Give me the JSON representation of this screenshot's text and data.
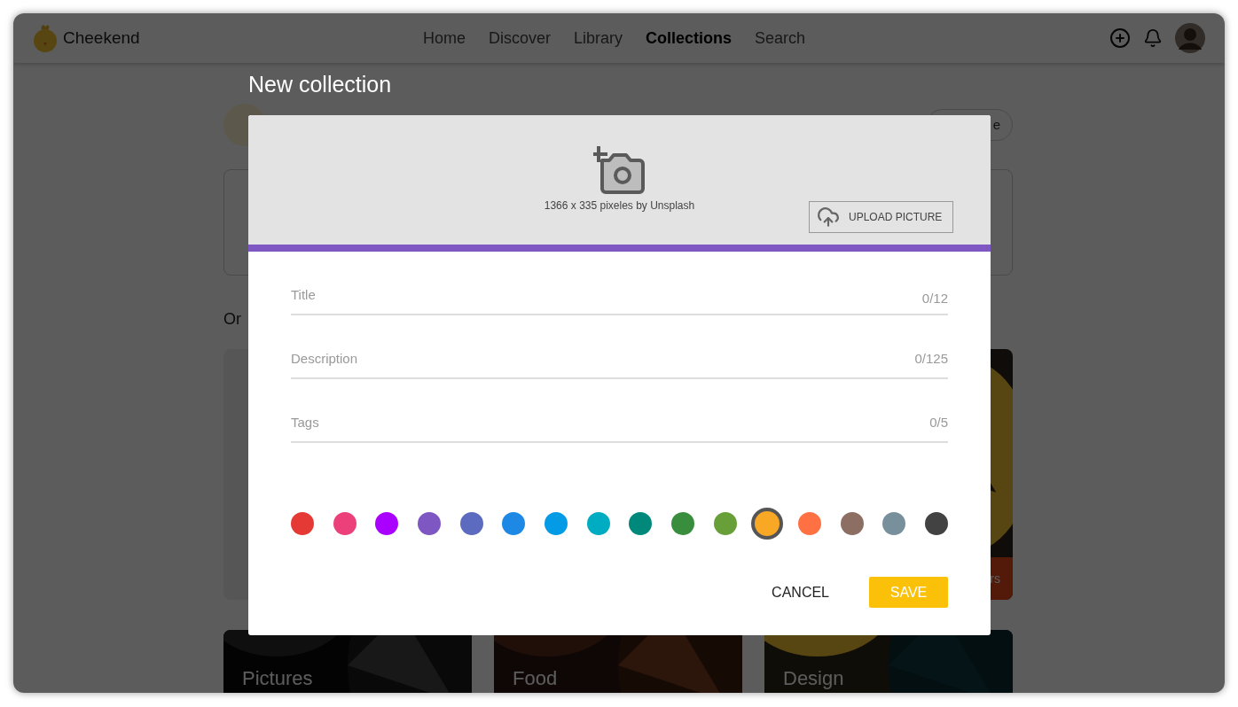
{
  "app": {
    "name": "Cheekend"
  },
  "nav": [
    {
      "label": "Home",
      "selected": false
    },
    {
      "label": "Discover",
      "selected": false
    },
    {
      "label": "Library",
      "selected": false
    },
    {
      "label": "Collections",
      "selected": true
    },
    {
      "label": "Search",
      "selected": false
    }
  ],
  "background": {
    "pill_button": "e",
    "section_heading": "Or",
    "card_band": "rs",
    "bottom_cards": [
      {
        "title": "Pictures",
        "kind": "dark"
      },
      {
        "title": "Food",
        "kind": "warm"
      },
      {
        "title": "Design",
        "kind": "bright"
      }
    ]
  },
  "dialog": {
    "heading": "New collection",
    "cover": {
      "caption": "1366 x 335 pixeles by Unsplash",
      "upload_button": "UPLOAD PICTURE"
    },
    "fields": [
      {
        "placeholder": "Title",
        "counter": "0/12"
      },
      {
        "placeholder": "Description",
        "counter": "0/125"
      },
      {
        "placeholder": "Tags",
        "counter": "0/5"
      }
    ],
    "colors": [
      {
        "color": "#e53935",
        "selected": false
      },
      {
        "color": "#ec407a",
        "selected": false
      },
      {
        "color": "#aa00ff",
        "selected": false
      },
      {
        "color": "#7e57c2",
        "selected": false
      },
      {
        "color": "#5c6bc0",
        "selected": false
      },
      {
        "color": "#1e88e5",
        "selected": false
      },
      {
        "color": "#039be5",
        "selected": false
      },
      {
        "color": "#00acc1",
        "selected": false
      },
      {
        "color": "#00897b",
        "selected": false
      },
      {
        "color": "#388e3c",
        "selected": false
      },
      {
        "color": "#689f38",
        "selected": false
      },
      {
        "color": "#f9a825",
        "selected": true
      },
      {
        "color": "#ff7043",
        "selected": false
      },
      {
        "color": "#8d6e63",
        "selected": false
      },
      {
        "color": "#78909c",
        "selected": false
      },
      {
        "color": "#424242",
        "selected": false
      }
    ],
    "actions": {
      "cancel": "CANCEL",
      "save": "SAVE"
    }
  }
}
